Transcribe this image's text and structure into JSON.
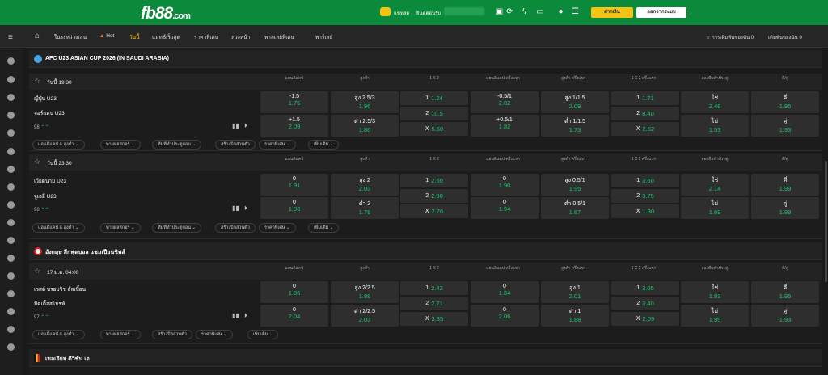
{
  "header": {
    "logo_main": "fb88",
    "logo_suffix": ".com",
    "chat_label": "แชทสด",
    "balance_label": "ยินดีต้อนรับ",
    "deposit_label": "ฝากเงิน",
    "logout_label": "ออกจากระบบ",
    "accent": "#f3c315",
    "brand": "#0a8a3a"
  },
  "nav": {
    "items": [
      "ในระหว่างเล่น",
      "Hot",
      "วันนี้",
      "แมทช์เร็วสุด",
      "ราคาพิเศษ",
      "ล่วงหน้า",
      "พาลเลย์พิเศษ",
      "พาร์เลย์"
    ],
    "active_index": 2,
    "right_open": "การเดิมพันของฉัน 0",
    "right_settled": "เดิมพันของฉัน 0"
  },
  "columns": [
    "แฮนดิแคป",
    "สูงต่ำ",
    "1 X 2",
    "แฮนดิแคป ครึ่งแรก",
    "สูงต่ำ ครึ่งแรก",
    "1 X 2 ครึ่งแรก",
    "ลองทีมทำประตู",
    "คี่/คู่"
  ],
  "leagues": [
    {
      "name": "AFC U23 ASIAN CUP 2026 (IN SAUDI ARABIA)",
      "matches": [
        {
          "time": "วันนี้ 19:30",
          "home": "ญี่ปุ่น U23",
          "away": "จอร์แดน U23",
          "count": "98",
          "rows": [
            {
              "hdp": [
                "-1.5",
                "1.75"
              ],
              "ou": [
                "สูง 2.5/3",
                "1.96"
              ],
              "hdp1": [
                "-0.5/1",
                "2.02"
              ],
              "ou1": [
                "สูง 1/1.5",
                "2.09"
              ],
              "goal": [
                "ใช่",
                "2.46"
              ],
              "oe": [
                "คี่",
                "1.95"
              ]
            },
            {
              "hdp": [
                "+1.5",
                "2.09"
              ],
              "ou": [
                "ต่ำ 2.5/3",
                "1.86"
              ],
              "hdp1": [
                "+0.5/1",
                "1.82"
              ],
              "ou1": [
                "ต่ำ 1/1.5",
                "1.73"
              ],
              "goal": [
                "ไม่",
                "1.53"
              ],
              "oe": [
                "คู่",
                "1.93"
              ]
            }
          ],
          "x12": [
            [
              "1",
              "1.24"
            ],
            [
              "2",
              "10.5"
            ],
            [
              "X",
              "5.50"
            ]
          ],
          "x121": [
            [
              "1",
              "1.71"
            ],
            [
              "2",
              "8.40"
            ],
            [
              "X",
              "2.52"
            ]
          ],
          "tabs": [
            "แฮนดิแคป & สูงต่ำ",
            "ทายผลสกอร์",
            "ทีมที่ทำประตูก่อน",
            "สร้างบิลส่วนตัว",
            "ราคาพิเศษ",
            "เพิ่มเติม"
          ]
        },
        {
          "time": "วันนี้ 23:30",
          "home": "เวียดนาม U23",
          "away": "จูเออี U23",
          "count": "98",
          "rows": [
            {
              "hdp": [
                "0",
                "1.91"
              ],
              "ou": [
                "สูง 2",
                "2.03"
              ],
              "hdp1": [
                "0",
                "1.90"
              ],
              "ou1": [
                "สูง 0.5/1",
                "1.95"
              ],
              "goal": [
                "ใช่",
                "2.14"
              ],
              "oe": [
                "คี่",
                "1.99"
              ]
            },
            {
              "hdp": [
                "0",
                "1.93"
              ],
              "ou": [
                "ต่ำ 2",
                "1.79"
              ],
              "hdp1": [
                "0",
                "1.94"
              ],
              "ou1": [
                "ต่ำ 0.5/1",
                "1.87"
              ],
              "goal": [
                "ไม่",
                "1.69"
              ],
              "oe": [
                "คู่",
                "1.89"
              ]
            }
          ],
          "x12": [
            [
              "1",
              "2.60"
            ],
            [
              "2",
              "2.90"
            ],
            [
              "X",
              "2.76"
            ]
          ],
          "x121": [
            [
              "1",
              "3.60"
            ],
            [
              "2",
              "3.75"
            ],
            [
              "X",
              "1.80"
            ]
          ],
          "tabs": [
            "แฮนดิแคป & สูงต่ำ",
            "ทายผลสกอร์",
            "ทีมที่ทำประตูก่อน",
            "สร้างบิลส่วนตัว",
            "ราคาพิเศษ",
            "เพิ่มเติม"
          ]
        }
      ]
    },
    {
      "name": "อังกฤษ ลีกฟุตบอล แชมเปียนชิพส์",
      "matches": [
        {
          "time": "17 ม.ค. 04:00",
          "home": "เวสต์ บรอมวิช อัลเบี้ยน",
          "away": "มิดเดิ้ลสโบรห์",
          "count": "97",
          "rows": [
            {
              "hdp": [
                "0",
                "1.86"
              ],
              "ou": [
                "สูง 2/2.5",
                "1.86"
              ],
              "hdp1": [
                "0",
                "1.84"
              ],
              "ou1": [
                "สูง 1",
                "2.01"
              ],
              "goal": [
                "ใช่",
                "1.83"
              ],
              "oe": [
                "คี่",
                "1.95"
              ]
            },
            {
              "hdp": [
                "0",
                "2.04"
              ],
              "ou": [
                "ต่ำ 2/2.5",
                "2.03"
              ],
              "hdp1": [
                "0",
                "2.06"
              ],
              "ou1": [
                "ต่ำ 1",
                "1.88"
              ],
              "goal": [
                "ไม่",
                "1.95"
              ],
              "oe": [
                "คู่",
                "1.93"
              ]
            }
          ],
          "x12": [
            [
              "1",
              "2.42"
            ],
            [
              "2",
              "2.71"
            ],
            [
              "X",
              "3.35"
            ]
          ],
          "x121": [
            [
              "1",
              "3.05"
            ],
            [
              "2",
              "3.40"
            ],
            [
              "X",
              "2.09"
            ]
          ],
          "tabs": [
            "แฮนดิแคป & สูงต่ำ",
            "ทายผลสกอร์",
            "สร้างบิลส่วนตัว",
            "ราคาพิเศษ",
            "เพิ่มเติม"
          ]
        }
      ]
    },
    {
      "name": "เบลเยียม ดิวิชั่น เอ",
      "matches": []
    }
  ],
  "icons": {
    "menu": "hamburger-icon",
    "home": "home-icon",
    "star": "star-icon",
    "stats": "stats-icon",
    "play": "play-icon"
  }
}
